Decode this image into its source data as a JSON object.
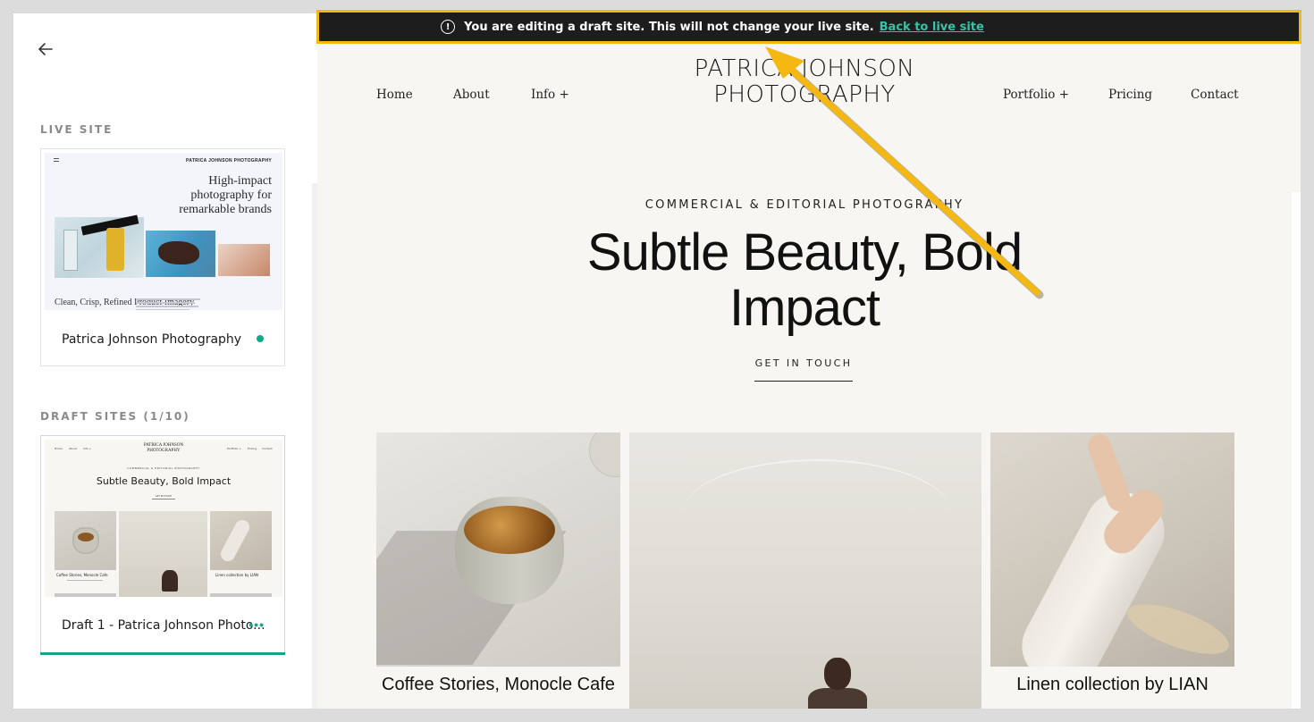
{
  "banner": {
    "message": "You are editing a draft site. This will not change your live site.",
    "link": "Back to live site",
    "icon": "alert-circle-icon"
  },
  "sidebar": {
    "back_icon": "arrow-left-icon",
    "live_label": "LIVE SITE",
    "live_card": {
      "name": "Patrica Johnson Photography",
      "status_color": "#13a78a",
      "thumb": {
        "logo": "PATRICA JOHNSON PHOTOGRAPHY",
        "hero": "High-impact photography for remarkable brands",
        "subtitle": "Clean, Crisp, Refined Product Imagery"
      }
    },
    "draft_label": "DRAFT SITES (1/10)",
    "draft_card": {
      "name": "Draft 1 - Patrica Johnson Photo...",
      "more": "•••",
      "thumb": {
        "nav": [
          "Home",
          "About",
          "Info +",
          "Portfolio +",
          "Pricing",
          "Contact"
        ],
        "logo": "PATRICA JOHNSON PHOTOGRAPHY",
        "subtitle": "COMMERCIAL & EDITORIAL PHOTOGRAPHY",
        "title": "Subtle Beauty, Bold Impact",
        "cta": "GET IN TOUCH",
        "captions": [
          "Coffee Stories, Monocle Cafe",
          "Linen collection by LIAN"
        ]
      }
    }
  },
  "site": {
    "nav_left": [
      "Home",
      "About",
      "Info +"
    ],
    "nav_right": [
      "Portfolio +",
      "Pricing",
      "Contact"
    ],
    "logo": "PATRICA JOHNSON PHOTOGRAPHY",
    "hero_subtitle": "COMMERCIAL & EDITORIAL PHOTOGRAPHY",
    "hero_title": "Subtle Beauty, Bold Impact",
    "cta": "GET IN TOUCH",
    "tiles": [
      {
        "caption": "Coffee Stories, Monocle Cafe"
      },
      {
        "caption": ""
      },
      {
        "caption": "Linen collection by LIAN"
      }
    ]
  },
  "colors": {
    "accent": "#13a78a",
    "banner_link": "#34c4a5",
    "highlight": "#f5b813",
    "banner_bg": "#1d1d1d"
  }
}
